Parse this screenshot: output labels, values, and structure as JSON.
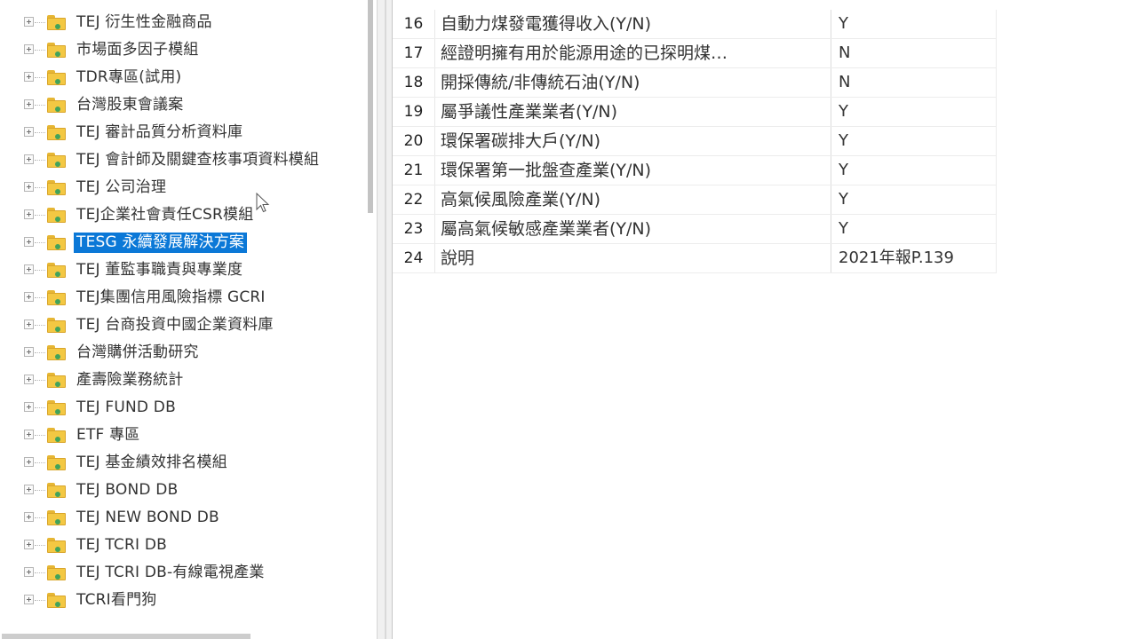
{
  "tree": {
    "items": [
      {
        "label": "TEJ 衍生性金融商品"
      },
      {
        "label": "市場面多因子模組"
      },
      {
        "label": "TDR專區(試用)"
      },
      {
        "label": "台灣股東會議案"
      },
      {
        "label": "TEJ 審計品質分析資料庫"
      },
      {
        "label": "TEJ 會計師及關鍵查核事項資料模組"
      },
      {
        "label": "TEJ 公司治理"
      },
      {
        "label": "TEJ企業社會責任CSR模組"
      },
      {
        "label": "TESG 永續發展解決方案",
        "selected": true
      },
      {
        "label": "TEJ 董監事職責與專業度"
      },
      {
        "label": "TEJ集團信用風險指標 GCRI"
      },
      {
        "label": "TEJ 台商投資中國企業資料庫"
      },
      {
        "label": "台灣購併活動研究"
      },
      {
        "label": "產壽險業務統計"
      },
      {
        "label": "TEJ FUND DB"
      },
      {
        "label": "ETF 專區"
      },
      {
        "label": "TEJ 基金績效排名模組"
      },
      {
        "label": "TEJ BOND DB"
      },
      {
        "label": "TEJ NEW BOND DB"
      },
      {
        "label": "TEJ TCRI DB"
      },
      {
        "label": "TEJ TCRI DB-有線電視產業"
      },
      {
        "label": "TCRI看門狗"
      }
    ]
  },
  "grid": {
    "rows": [
      {
        "num": "16",
        "field": "自動力煤發電獲得收入(Y/N)",
        "value": "Y"
      },
      {
        "num": "17",
        "field": "經證明擁有用於能源用途的已探明煤…",
        "value": "N"
      },
      {
        "num": "18",
        "field": "開採傳統/非傳統石油(Y/N)",
        "value": "N"
      },
      {
        "num": "19",
        "field": "屬爭議性產業業者(Y/N)",
        "value": "Y"
      },
      {
        "num": "20",
        "field": "環保署碳排大戶(Y/N)",
        "value": "Y"
      },
      {
        "num": "21",
        "field": "環保署第一批盤查產業(Y/N)",
        "value": "Y"
      },
      {
        "num": "22",
        "field": "高氣候風險產業(Y/N)",
        "value": "Y"
      },
      {
        "num": "23",
        "field": "屬高氣候敏感產業業者(Y/N)",
        "value": "Y"
      },
      {
        "num": "24",
        "field": "說明",
        "value": "2021年報P.139"
      }
    ]
  },
  "colors": {
    "selection": "#0b78d7",
    "folder": "#f3c843",
    "folder_badge": "#41a35b"
  }
}
